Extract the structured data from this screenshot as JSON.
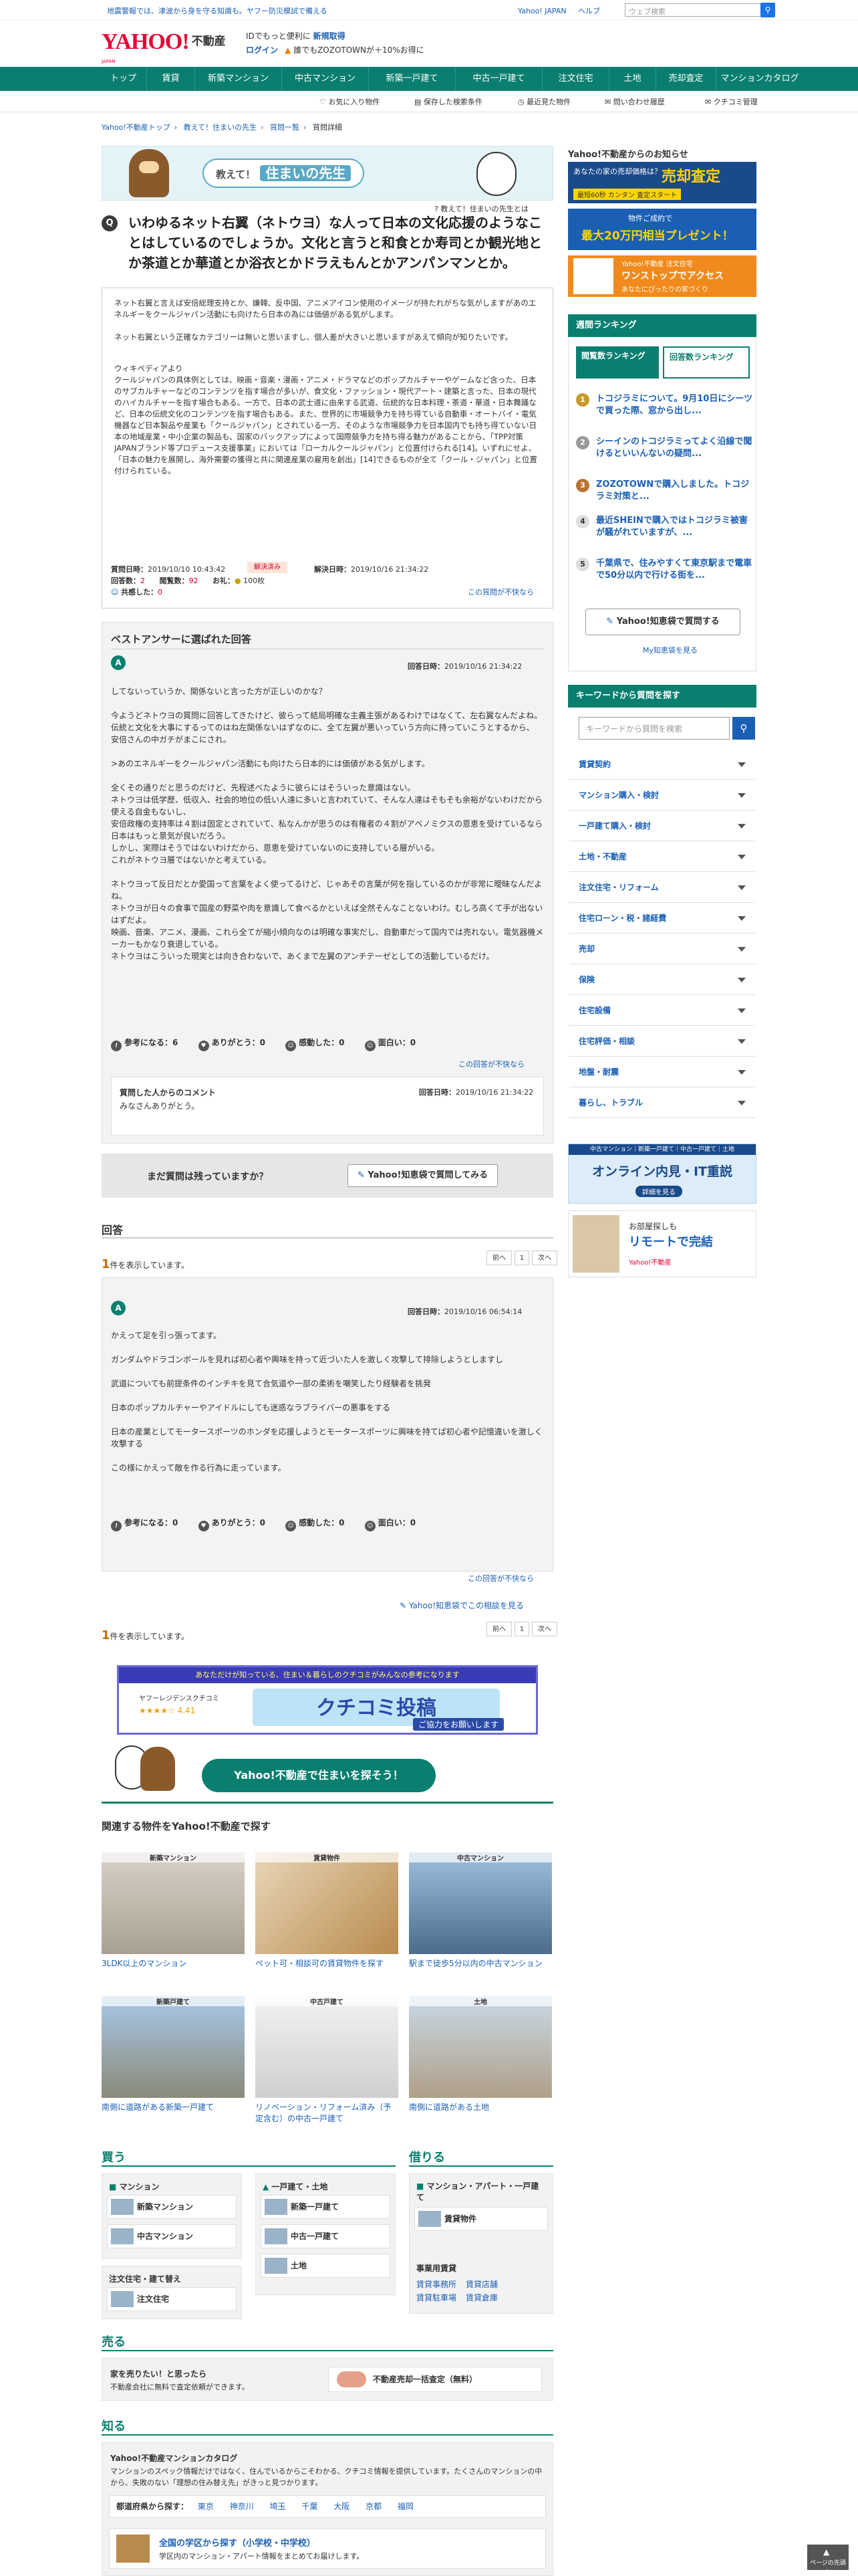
{
  "topbar": {
    "notice": "地震警報では、津波から身を守る知識も。ヤフー防災模試で備える",
    "links": [
      "Yahoo! JAPAN",
      "ヘルプ"
    ],
    "search_placeholder": "ウェブ検索"
  },
  "header": {
    "logo": "YAHOO!",
    "logo_sub": "JAPAN",
    "brand": "不動産",
    "promo1_prefix": "IDでもっと便利に",
    "promo1_link": "新規取得",
    "login": "ログイン",
    "promo2": "誰でもZOZOTOWNが＋10%お得に"
  },
  "nav": [
    "トップ",
    "賃貸",
    "新築マンション",
    "中古マンション",
    "新築一戸建て",
    "中古一戸建て",
    "注文住宅",
    "土地",
    "売却査定",
    "マンションカタログ"
  ],
  "subnav": [
    "お気に入り物件",
    "保存した検索条件",
    "最近見た物件",
    "問い合わせ履歴",
    "クチコミ管理"
  ],
  "breadcrumb": [
    "Yahoo!不動産トップ",
    "教えて！住まいの先生",
    "質問一覧",
    "質問詳細"
  ],
  "sensei": {
    "title_prefix": "教えて！",
    "title_main": "住まいの先生",
    "link": "教えて！住まいの先生とは"
  },
  "question": {
    "title": "いわゆるネット右翼（ネトウヨ）な人って日本の文化応援のようなことはしているのでしょうか。文化と言うと和食とか寿司とか観光地とか茶道とか華道とか浴衣とかドラえもんとかアンパンマンとか。",
    "body": [
      "ネット右翼と言えば安倍総理支持とか、嫌韓、反中国、アニメアイコン使用のイメージが持たれがちな気がしますがあのエネルギーをクールジャパン活動にも向けたら日本の為には価値がある気がします。",
      "ネット右翼という正確なカテゴリーは無いと思いますし、個人差が大きいと思いますがあえて傾向が知りたいです。",
      "ウィキペディアより\nクールジャパンの具体例としては、映画・音楽・漫画・アニメ・ドラマなどのポップカルチャーやゲームなど含った、日本のサブカルチャーなどのコンテンツを指す場合が多いが、食文化・ファッション・現代アート・建築と言った、日本の現代のハイカルチャーを指す場合もある。一方で、日本の武士道に由来する武道、伝統的な日本料理・茶道・華道・日本舞踊など、日本の伝統文化のコンテンツを指す場合もある。また、世界的に市場競争力を持ち得ている自動車・オートバイ・電気機器など日本製品や産業も「クールジャパン」とされている一方、そのような市場競争力を日本国内でも持ち得ていない日本の地域産業・中小企業の製品も、国家のバックアップによって国際競争力を持ち得る魅力があることから、「TPP対策JAPANブランド等プロデュース支援事業」においては「ローカルクールジャパン」と位置付けられる[14]。いずれにせよ、「日本の魅力を展開し、海外需要の獲得と共に関連産業の雇用を創出」[14]できるものが全て「クール・ジャパン」と位置付けられている。"
    ],
    "meta": {
      "asked_label": "質問日時：",
      "asked": "2019/10/10 10:43:42",
      "status": "解決済み",
      "resolved_label": "解決日時：",
      "resolved": "2019/10/16 21:34:22",
      "answers_label": "回答数：",
      "answers": "2",
      "views_label": "閲覧数：",
      "views": "92",
      "coins_label": "お礼：",
      "coins": "100枚",
      "empathy_label": "共感した：",
      "empathy": "0",
      "report": "この質問が不快なら"
    }
  },
  "best_answer": {
    "heading": "ベストアンサーに選ばれた回答",
    "avatar": "A",
    "date_label": "回答日時：",
    "date": "2019/10/16 21:34:22",
    "paragraphs": [
      "してないっていうか、関係ないと言った方が正しいのかな？",
      "今ようどネトウヨの質問に回答してきたけど、彼らって結局明確な主義主張があるわけではなくて、左右翼なんだよね。\n伝統と文化を大事にするってのはね左関係ないはずなのに、全て左翼が悪いっていう方向に持っていこうとするから、\n安倍さんの中ガチがまこにされ。",
      ">あのエネルギーをクールジャパン活動にも向けたら日本的には価値がある気がします。",
      "全くその通りだと思うのだけど、先程述べたように彼らにはそういった意識はない。\nネトウヨは低学歴、低収入、社会的地位の低い人達に多いと言われていて、そんな人達はそもそも余裕がないわけだから使える自金もないし、\n安倍政権の支持率は４割は固定とされていて、私なんかが思うのは有権者の４割がアベノミクスの恩恵を受けているなら日本はもっと景気が良いだろう。\nしかし、実際はそうではないわけだから、恩恵を受けていないのに支持している層がいる。\nこれがネトウヨ層ではないかと考えている。",
      "ネトウヨって反日だとか愛国って言葉をよく使ってるけど、じゃあその言葉が何を指しているのかが非常に曖昧なんだよね。\nネトウヨが日々の食事で国産の野菜や肉を意識して食べるかといえば全然そんなことないわけ。むしろ高くて手が出ないはずだよ。\n映画、音楽、アニメ、漫画、これら全てが縮小傾向なのは明確な事実だし、自動車だって国内では売れない。電気器機メーカーもかなり衰退している。\nネトウヨはこういった現実とは向き合わないで、あくまで左翼のアンチテーゼとしての活動しているだけ。"
    ],
    "reactions": [
      {
        "label": "参考になる：",
        "n": "6"
      },
      {
        "label": "ありがとう：",
        "n": "0"
      },
      {
        "label": "感動した：",
        "n": "0"
      },
      {
        "label": "面白い：",
        "n": "0"
      }
    ],
    "report": "この回答が不快なら",
    "comment_heading": "質問した人からのコメント",
    "comment_date": "2019/10/16 21:34:22",
    "comment_text": "みなさんありがとう。"
  },
  "prompt_box": {
    "text": "まだ質問は残っていますか？",
    "button": "Yahoo!知恵袋で質問してみる"
  },
  "answers_section": {
    "heading": "回答",
    "count": "1",
    "count_suffix": "件を表示しています。",
    "pager": [
      "前へ",
      "1",
      "次へ"
    ],
    "answer": {
      "avatar": "A",
      "date_label": "回答日時：",
      "date": "2019/10/16 06:54:14",
      "paragraphs": [
        "かえって足を引っ張ってます。",
        "ガンダムやドラゴンボールを見れば初心者や興味を持って近づいた人を激しく攻撃して排除しようとしますし",
        "武道についても前提条件のインチキを見て合気道や一部の柔術を嘲笑したり経験者を挑発",
        "日本のポップカルチャーやアイドルにしても迷惑なラブライバーの悪事をする",
        "日本の産業としてモータースポーツのホンダを応援しようとモータースポーツに興味を持てば初心者や記憶違いを激しく攻撃する",
        "この様にかえって敵を作る行為に走っています。"
      ],
      "reactions": [
        {
          "label": "参考になる：",
          "n": "0"
        },
        {
          "label": "ありがとう：",
          "n": "0"
        },
        {
          "label": "感動した：",
          "n": "0"
        },
        {
          "label": "面白い：",
          "n": "0"
        }
      ],
      "report": "この回答が不快なら"
    },
    "chiebukuro_link": "Yahoo!知恵袋でこの相談を見る"
  },
  "kuchikomi": {
    "tagline": "あなただけが知っている、住まい＆暮らしのクチコミがみんなの参考になります",
    "service": "ヤフーレジデンスクチコミ",
    "stars": "4.41",
    "title": "クチコミ投稿",
    "cta": "ご協力をお願いします"
  },
  "bubble": "Yahoo!不動産で住まいを探そう！",
  "related": {
    "heading": "関連する物件をYahoo!不動産で探す",
    "items": [
      {
        "tag": "新築マンション",
        "caption": "3LDK以上のマンション"
      },
      {
        "tag": "賃貸物件",
        "caption": "ペット可・相談可の賃貸物件を探す"
      },
      {
        "tag": "中古マンション",
        "caption": "駅まで徒歩5分以内の中古マンション"
      },
      {
        "tag": "新築戸建て",
        "caption": "南側に道路がある新築一戸建て"
      },
      {
        "tag": "中古戸建て",
        "caption": "リノベーション・リフォーム済み（予定含む）の中古一戸建て"
      },
      {
        "tag": "土地",
        "caption": "南側に道路がある土地"
      }
    ]
  },
  "buy": {
    "heading": "買う",
    "mansion_label": "マンション",
    "mansion_items": [
      "新築マンション",
      "中古マンション"
    ],
    "house_label": "一戸建て・土地",
    "house_items": [
      "新築一戸建て",
      "中古一戸建て",
      "土地"
    ],
    "order_label": "注文住宅・建て替え",
    "order_item": "注文住宅"
  },
  "rent": {
    "heading": "借りる",
    "label": "マンション・アパート・一戸建て",
    "item": "賃貸物件",
    "biz_label": "事業用賃貸",
    "biz_items": [
      "賃貸事務所",
      "賃貸店舗",
      "賃貸駐車場",
      "賃貸倉庫"
    ]
  },
  "sell": {
    "heading": "売る",
    "line1": "家を売りたい！と思ったら",
    "line2": "不動産会社に無料で査定依頼ができます。",
    "button": "不動産売却一括査定（無料）"
  },
  "know": {
    "heading": "知る",
    "catalog_title": "Yahoo!不動産マンションカタログ",
    "catalog_desc": "マンションのスペック情報だけではなく、住んでいるからこそわかる、クチコミ情報を提供しています。たくさんのマンションの中から、失敗のない「理想の住み替え先」がきっと見つかります。",
    "pref_label": "都道府県から探す：",
    "prefs": [
      "東京",
      "神奈川",
      "埼玉",
      "千葉",
      "大阪",
      "京都",
      "福岡"
    ],
    "school_title": "全国の学区から探す（小学校・中学校）",
    "school_desc": "学区内のマンション・アパート情報をまとめてお届けします。"
  },
  "sidebar": {
    "ad_heading": "Yahoo!不動産からのお知らせ",
    "ads": [
      {
        "text": "あなたの家の売却価格は？",
        "big": "売却査定",
        "sub": "最短60秒 カンタン 査定スタート"
      },
      {
        "text": "物件ご成約で",
        "big": "最大20万円相当プレゼント！",
        "sub": ""
      },
      {
        "text": "Yahoo!不動産 注文住宅",
        "big": "ワンストップでアクセス",
        "sub": "あなたにぴったりの家づくり"
      }
    ],
    "ranking_heading": "週間ランキング",
    "tabs": [
      "閲覧数ランキング",
      "回答数ランキング"
    ],
    "ranking": [
      "トコジラミについて。9月10日にシーツで買った際、窓から出し...",
      "シーインのトコジラミってよく沿線で聞けるといいんないの疑問...",
      "ZOZOTOWNで購入しました。トコジラミ対策と...",
      "最近SHEINで購入ではトコジラミ被害が騒がれていますが、...",
      "千葉県で、住みやすくて東京駅まで電車で50分以内で行ける街を..."
    ],
    "ask_button": "Yahoo!知恵袋で質問する",
    "my_link": "My知恵袋を見る",
    "kw_heading": "キーワードから質問を探す",
    "kw_placeholder": "キーワードから質問を検索",
    "categories": [
      "賃貸契約",
      "マンション購入・検討",
      "一戸建て購入・検討",
      "土地・不動産",
      "注文住宅・リフォーム",
      "住宅ローン・税・諸経費",
      "売却",
      "保険",
      "住宅設備",
      "住宅評価・相談",
      "地盤・耐震",
      "暮らし、トラブル"
    ],
    "online_ad": {
      "top": "中古マンション｜新築一戸建て｜中古一戸建て｜土地",
      "title": "オンライン内見・IT重説",
      "sub": "詳細を見る"
    },
    "remote_ad": {
      "top": "お部屋探しも",
      "title": "リモートで完結",
      "sub": "Yahoo!不動産"
    }
  },
  "footer": {
    "top_button": "ページの先頭へ"
  },
  "colors": {
    "brand": "#0a7f6f",
    "accent": "#e60033",
    "link": "#1a5fb4"
  }
}
